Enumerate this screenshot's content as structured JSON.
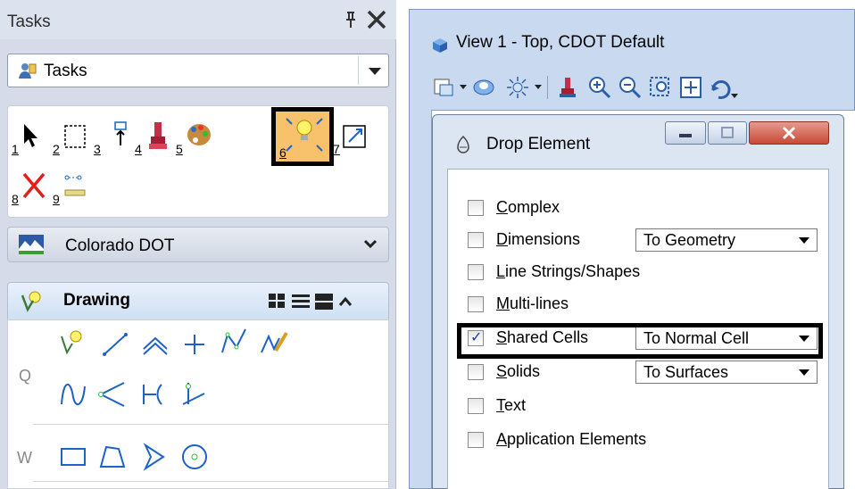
{
  "tasks_panel": {
    "title": "Tasks",
    "pin_glyph": "ᵖ",
    "close_glyph": "✕",
    "task_select_value": "Tasks",
    "tools": [
      {
        "num": "1",
        "icon": "arrow-select-icon"
      },
      {
        "num": "2",
        "icon": "dashed-box-icon"
      },
      {
        "num": "3",
        "icon": "place-element-icon"
      },
      {
        "num": "4",
        "icon": "paint-brush-icon"
      },
      {
        "num": "5",
        "icon": "palette-icon"
      },
      {
        "num": "6",
        "icon": "drop-element-icon"
      },
      {
        "num": "7",
        "icon": "scale-icon"
      },
      {
        "num": "8",
        "icon": "delete-x-icon"
      },
      {
        "num": "9",
        "icon": "measure-icon"
      }
    ],
    "colorado_section": "Colorado DOT",
    "drawing_section": "Drawing",
    "row_letters": [
      "Q",
      "W"
    ]
  },
  "view_window": {
    "title": "View 1 - Top, CDOT Default"
  },
  "dialog": {
    "title": "Drop Element",
    "options": [
      {
        "label": "Complex",
        "ul": "C",
        "rest": "omplex",
        "checked": false,
        "combo": ""
      },
      {
        "label": "Dimensions",
        "ul": "D",
        "rest": "imensions",
        "checked": false,
        "combo": "To Geometry"
      },
      {
        "label": "Line Strings/Shapes",
        "ul": "L",
        "rest": "ine Strings/Shapes",
        "checked": false,
        "combo": ""
      },
      {
        "label": "Multi-lines",
        "ul": "M",
        "rest": "ulti-lines",
        "checked": false,
        "combo": ""
      },
      {
        "label": "Shared Cells",
        "ul": "S",
        "rest": "hared Cells",
        "checked": true,
        "combo": "To Normal Cell"
      },
      {
        "label": "Solids",
        "ul": "S",
        "rest": "olids",
        "checked": false,
        "combo": "To Surfaces"
      },
      {
        "label": "Text",
        "ul": "T",
        "rest": "ext",
        "checked": false,
        "combo": ""
      },
      {
        "label": "Application Elements",
        "ul": "A",
        "rest": "pplication Elements",
        "checked": false,
        "combo": ""
      }
    ]
  },
  "colors": {
    "panel_bg": "#d6dbe9",
    "highlight_tool": "#f7c26b",
    "window_frame": "#c9daf0",
    "close_button": "#c84a36",
    "check_mark": "#1f3e9e"
  }
}
